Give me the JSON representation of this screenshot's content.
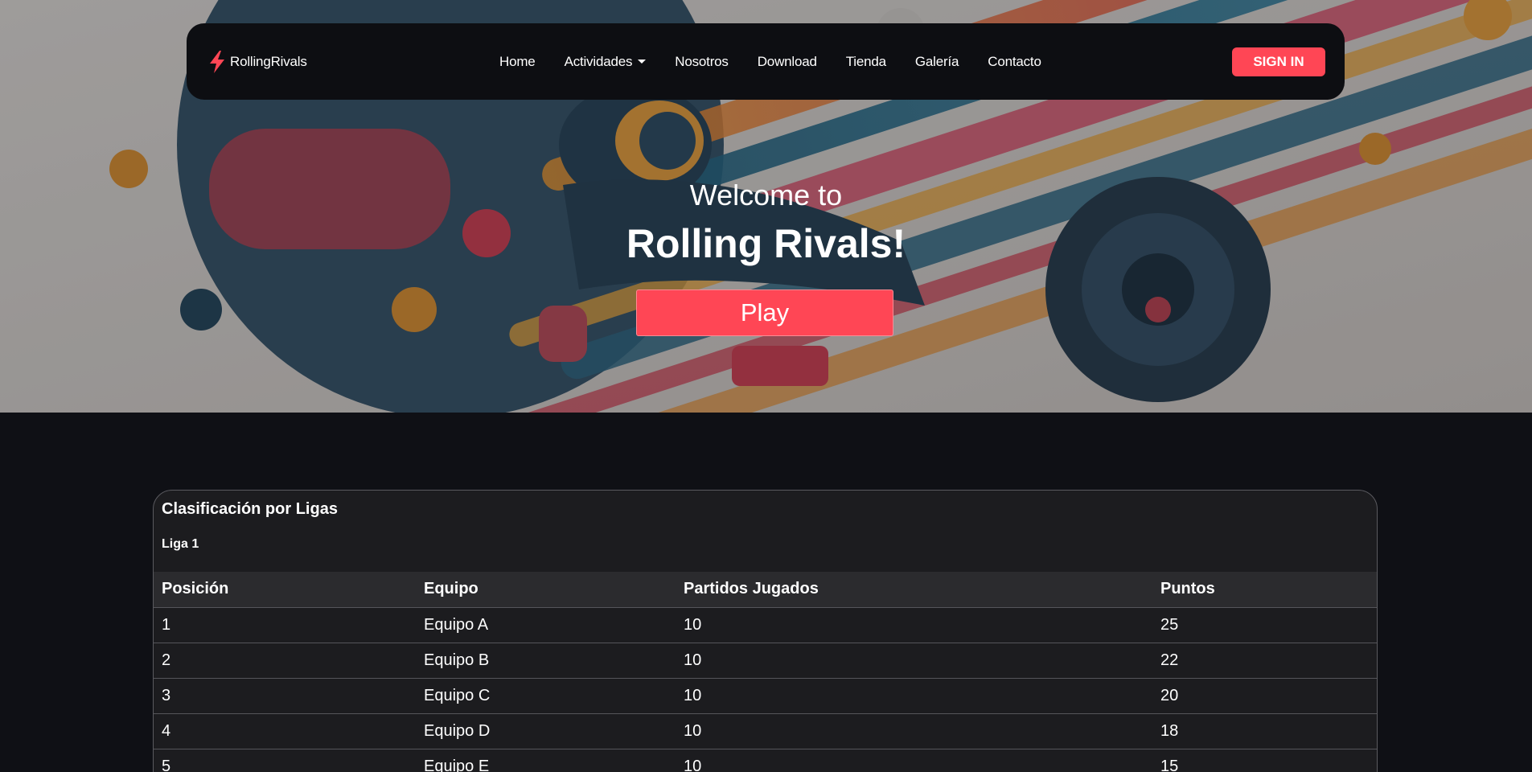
{
  "brand": {
    "name": "RollingRivals",
    "icon": "lightning-bolt-icon",
    "accent": "#ff4655"
  },
  "nav": {
    "items": [
      {
        "label": "Home"
      },
      {
        "label": "Actividades",
        "dropdown": true
      },
      {
        "label": "Nosotros"
      },
      {
        "label": "Download"
      },
      {
        "label": "Tienda"
      },
      {
        "label": "Galería"
      },
      {
        "label": "Contacto"
      }
    ],
    "signin_label": "SIGN IN"
  },
  "hero": {
    "welcome": "Welcome to",
    "title": "Rolling Rivals!",
    "play_label": "Play"
  },
  "standings": {
    "title": "Clasificación por Ligas",
    "league": "Liga 1",
    "columns": [
      "Posición",
      "Equipo",
      "Partidos Jugados",
      "Puntos"
    ],
    "rows": [
      [
        "1",
        "Equipo A",
        "10",
        "25"
      ],
      [
        "2",
        "Equipo B",
        "10",
        "22"
      ],
      [
        "3",
        "Equipo C",
        "10",
        "20"
      ],
      [
        "4",
        "Equipo D",
        "10",
        "18"
      ],
      [
        "5",
        "Equipo E",
        "10",
        "15"
      ]
    ]
  },
  "colors": {
    "page_bg": "#0f1015",
    "navbar_bg": "#0d0e12",
    "accent": "#ff4655",
    "card_bg": "#1c1c1f",
    "table_header_bg": "#2b2b2e"
  }
}
